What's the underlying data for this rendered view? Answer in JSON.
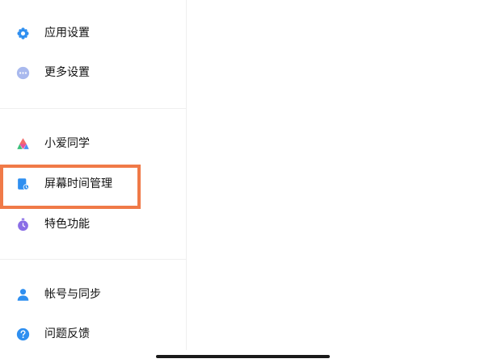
{
  "settings_menu": {
    "items": [
      {
        "label": "应用设置",
        "icon": "gear-icon",
        "color": "#2f8ff0"
      },
      {
        "label": "更多设置",
        "icon": "more-dots-icon",
        "color": "#8fa6e8"
      },
      {
        "label": "小爱同学",
        "icon": "xiaoai-icon",
        "color": "#e8519a"
      },
      {
        "label": "屏幕时间管理",
        "icon": "screen-time-icon",
        "color": "#2f8ff0"
      },
      {
        "label": "特色功能",
        "icon": "feature-timer-icon",
        "color": "#8a6ee6"
      },
      {
        "label": "帐号与同步",
        "icon": "account-person-icon",
        "color": "#2f8ff0"
      },
      {
        "label": "问题反馈",
        "icon": "help-question-icon",
        "color": "#2f8ff0"
      }
    ]
  },
  "highlight": {
    "target": "屏幕时间管理",
    "color": "#f07a48"
  }
}
